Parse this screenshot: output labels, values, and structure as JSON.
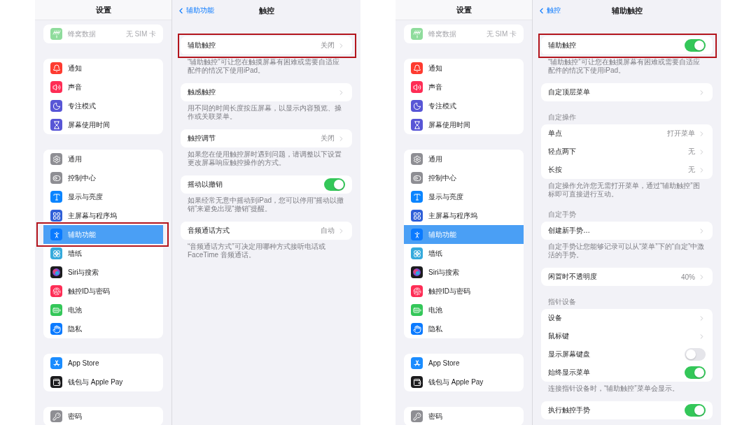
{
  "screens": [
    {
      "sidebar": {
        "title": "设置",
        "groups": [
          [
            {
              "label": "蜂窝数据",
              "value": "无 SIM 卡",
              "color": "#8fdc9c",
              "disabled": true,
              "selected": false,
              "outlined": false
            }
          ],
          [
            {
              "label": "通知",
              "color": "#fe3b30",
              "disabled": false,
              "selected": false,
              "outlined": false
            },
            {
              "label": "声音",
              "color": "#fe2d55",
              "disabled": false,
              "selected": false,
              "outlined": false
            },
            {
              "label": "专注模式",
              "color": "#5856d6",
              "disabled": false,
              "selected": false,
              "outlined": false
            },
            {
              "label": "屏幕使用时间",
              "color": "#5856d6",
              "disabled": false,
              "selected": false,
              "outlined": false
            }
          ],
          [
            {
              "label": "通用",
              "color": "#8e8e93",
              "disabled": false,
              "selected": false,
              "outlined": false
            },
            {
              "label": "控制中心",
              "color": "#8e8e93",
              "disabled": false,
              "selected": false,
              "outlined": false
            },
            {
              "label": "显示与亮度",
              "color": "#0a84ff",
              "disabled": false,
              "selected": false,
              "outlined": false
            },
            {
              "label": "主屏幕与程序坞",
              "color": "#2f5fd8",
              "disabled": false,
              "selected": false,
              "outlined": false
            },
            {
              "label": "辅助功能",
              "color": "#0a7aff",
              "disabled": false,
              "selected": true,
              "outlined": true
            },
            {
              "label": "墙纸",
              "color": "#35aadc",
              "disabled": false,
              "selected": false,
              "outlined": false
            },
            {
              "label": "Siri与搜索",
              "color": "#1c1c1e",
              "disabled": false,
              "selected": false,
              "outlined": false
            },
            {
              "label": "触控ID与密码",
              "color": "#fe2d55",
              "disabled": false,
              "selected": false,
              "outlined": false
            },
            {
              "label": "电池",
              "color": "#34c759",
              "disabled": false,
              "selected": false,
              "outlined": false
            },
            {
              "label": "隐私",
              "color": "#0a7aff",
              "disabled": false,
              "selected": false,
              "outlined": false
            }
          ],
          [
            {
              "label": "App Store",
              "color": "#1a8cff",
              "disabled": false,
              "selected": false,
              "outlined": false
            },
            {
              "label": "钱包与 Apple Pay",
              "color": "#1c1c1e",
              "disabled": false,
              "selected": false,
              "outlined": false
            }
          ],
          [
            {
              "label": "密码",
              "color": "#8e8e93",
              "disabled": false,
              "selected": false,
              "outlined": false
            }
          ]
        ]
      },
      "detail": {
        "back": "辅助功能",
        "title": "触控",
        "sections": [
          {
            "rows": [
              {
                "kind": "link",
                "label": "辅助触控",
                "value": "关闭",
                "outlined": true
              }
            ],
            "footer": "“辅助触控”可让您在触摸屏幕有困难或需要自适应配件的情况下使用iPad。"
          },
          {
            "rows": [
              {
                "kind": "link",
                "label": "触感触控",
                "outlined": false
              }
            ],
            "footer": "用不同的时间长度按压屏幕，以显示内容预览、操作或关联菜单。"
          },
          {
            "rows": [
              {
                "kind": "link",
                "label": "触控调节",
                "value": "关闭",
                "outlined": false
              }
            ],
            "footer": "如果您在使用触控屏时遇到问题，请调整以下设置更改屏幕响应触控操作的方式。"
          },
          {
            "rows": [
              {
                "kind": "toggle",
                "label": "摇动以撤销",
                "on": true,
                "outlined": false
              }
            ],
            "footer": "如果经常无意中摇动到iPad，您可以停用“摇动以撤销”来避免出现“撤销”提醒。"
          },
          {
            "rows": [
              {
                "kind": "link",
                "label": "音频通话方式",
                "value": "自动",
                "outlined": false
              }
            ],
            "footer": "“音频通话方式”可决定用哪种方式接听电话或 FaceTime 音频通话。"
          }
        ]
      }
    },
    {
      "sidebar": {
        "title": "设置",
        "groups": [
          [
            {
              "label": "蜂窝数据",
              "value": "无 SIM 卡",
              "color": "#8fdc9c",
              "disabled": true,
              "selected": false,
              "outlined": false
            }
          ],
          [
            {
              "label": "通知",
              "color": "#fe3b30",
              "disabled": false,
              "selected": false,
              "outlined": false
            },
            {
              "label": "声音",
              "color": "#fe2d55",
              "disabled": false,
              "selected": false,
              "outlined": false
            },
            {
              "label": "专注模式",
              "color": "#5856d6",
              "disabled": false,
              "selected": false,
              "outlined": false
            },
            {
              "label": "屏幕使用时间",
              "color": "#5856d6",
              "disabled": false,
              "selected": false,
              "outlined": false
            }
          ],
          [
            {
              "label": "通用",
              "color": "#8e8e93",
              "disabled": false,
              "selected": false,
              "outlined": false
            },
            {
              "label": "控制中心",
              "color": "#8e8e93",
              "disabled": false,
              "selected": false,
              "outlined": false
            },
            {
              "label": "显示与亮度",
              "color": "#0a84ff",
              "disabled": false,
              "selected": false,
              "outlined": false
            },
            {
              "label": "主屏幕与程序坞",
              "color": "#2f5fd8",
              "disabled": false,
              "selected": false,
              "outlined": false
            },
            {
              "label": "辅助功能",
              "color": "#0a7aff",
              "disabled": false,
              "selected": true,
              "outlined": false
            },
            {
              "label": "墙纸",
              "color": "#35aadc",
              "disabled": false,
              "selected": false,
              "outlined": false
            },
            {
              "label": "Siri与搜索",
              "color": "#1c1c1e",
              "disabled": false,
              "selected": false,
              "outlined": false
            },
            {
              "label": "触控ID与密码",
              "color": "#fe2d55",
              "disabled": false,
              "selected": false,
              "outlined": false
            },
            {
              "label": "电池",
              "color": "#34c759",
              "disabled": false,
              "selected": false,
              "outlined": false
            },
            {
              "label": "隐私",
              "color": "#0a7aff",
              "disabled": false,
              "selected": false,
              "outlined": false
            }
          ],
          [
            {
              "label": "App Store",
              "color": "#1a8cff",
              "disabled": false,
              "selected": false,
              "outlined": false
            },
            {
              "label": "钱包与 Apple Pay",
              "color": "#1c1c1e",
              "disabled": false,
              "selected": false,
              "outlined": false
            }
          ],
          [
            {
              "label": "密码",
              "color": "#8e8e93",
              "disabled": false,
              "selected": false,
              "outlined": false
            }
          ]
        ]
      },
      "detail": {
        "back": "触控",
        "title": "辅助触控",
        "sections": [
          {
            "rows": [
              {
                "kind": "toggle",
                "label": "辅助触控",
                "on": true,
                "outlined": true
              }
            ],
            "footer": "“辅助触控”可让您在触摸屏幕有困难或需要自适应配件的情况下使用iPad。"
          },
          {
            "rows": [
              {
                "kind": "link",
                "label": "自定顶层菜单",
                "outlined": false
              }
            ]
          },
          {
            "header": "自定操作",
            "rows": [
              {
                "kind": "link",
                "label": "单点",
                "value": "打开菜单",
                "outlined": false
              },
              {
                "kind": "link",
                "label": "轻点两下",
                "value": "无",
                "outlined": false
              },
              {
                "kind": "link",
                "label": "长按",
                "value": "无",
                "outlined": false
              }
            ],
            "footer": "自定操作允许您无需打开菜单，通过“辅助触控”图标即可直接进行互动。"
          },
          {
            "header": "自定手势",
            "rows": [
              {
                "kind": "link",
                "label": "创建新手势…",
                "outlined": false
              }
            ],
            "footer": "自定手势让您能够记录可以从“菜单”下的“自定”中激活的手势。"
          },
          {
            "rows": [
              {
                "kind": "link",
                "label": "闲置时不透明度",
                "value": "40%",
                "outlined": false
              }
            ]
          },
          {
            "header": "指针设备",
            "rows": [
              {
                "kind": "link",
                "label": "设备",
                "outlined": false
              },
              {
                "kind": "link",
                "label": "鼠标键",
                "outlined": false
              },
              {
                "kind": "toggle",
                "label": "显示屏幕键盘",
                "on": false,
                "outlined": false
              },
              {
                "kind": "toggle",
                "label": "始终显示菜单",
                "on": true,
                "outlined": false
              }
            ],
            "footer": "连接指针设备时，“辅助触控”菜单会显示。"
          },
          {
            "rows": [
              {
                "kind": "toggle",
                "label": "执行触控手势",
                "on": true,
                "outlined": false
              }
            ]
          }
        ]
      }
    }
  ]
}
